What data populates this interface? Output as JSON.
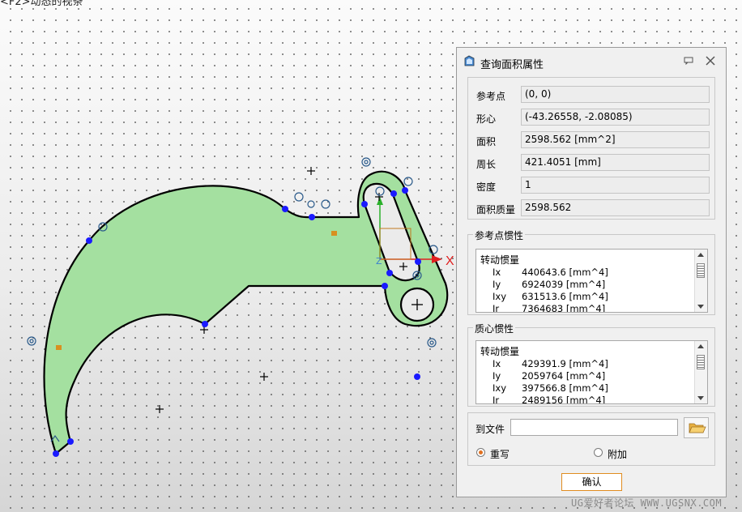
{
  "canvas": {
    "top_hint": "<F2>动态的视条",
    "axis_label": "X",
    "fill_color": "#a4e0a0",
    "point_color": "#1a1aff"
  },
  "dialog": {
    "title": "查询面积属性",
    "fields": [
      {
        "label": "参考点",
        "value": "(0, 0)"
      },
      {
        "label": "形心",
        "value": "(-43.26558, -2.08085)"
      },
      {
        "label": "面积",
        "value": "2598.562  [mm^2]"
      },
      {
        "label": "周长",
        "value": "421.4051  [mm]"
      },
      {
        "label": "密度",
        "value": "1"
      },
      {
        "label": "面积质量",
        "value": "2598.562"
      }
    ],
    "ref_inertia": {
      "title": "参考点惯性",
      "header": "转动惯量",
      "items": [
        {
          "k": "Ix",
          "v": "440643.6  [mm^4]"
        },
        {
          "k": "Iy",
          "v": "6924039  [mm^4]"
        },
        {
          "k": "Ixy",
          "v": "631513.6  [mm^4]"
        },
        {
          "k": "Ir",
          "v": "7364683  [mm^4]"
        }
      ]
    },
    "centroid_inertia": {
      "title": "质心惯性",
      "header": "转动惯量",
      "items": [
        {
          "k": "Ix",
          "v": "429391.9  [mm^4]"
        },
        {
          "k": "Iy",
          "v": "2059764  [mm^4]"
        },
        {
          "k": "Ixy",
          "v": "397566.8  [mm^4]"
        },
        {
          "k": "Ir",
          "v": "2489156  [mm^4]"
        }
      ]
    },
    "file": {
      "label": "到文件",
      "value": "",
      "overwrite_label": "重写",
      "append_label": "附加",
      "selected": "overwrite"
    },
    "ok_label": "确认"
  },
  "watermark": "UG爱好者论坛 WWW.UGSNX.COM"
}
